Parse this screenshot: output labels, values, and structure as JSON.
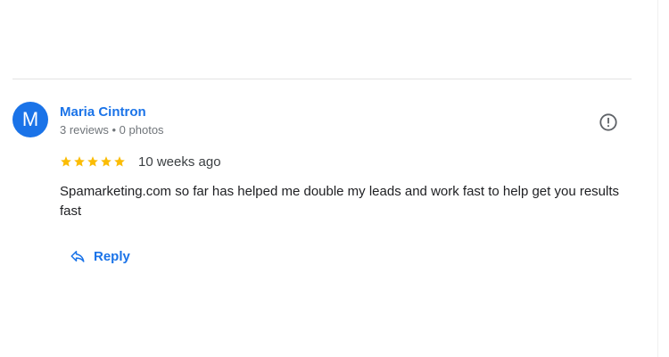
{
  "review": {
    "author": {
      "initial": "M",
      "name": "Maria Cintron",
      "meta": "3 reviews • 0 photos",
      "avatar_color": "#1a73e8"
    },
    "rating": {
      "stars": 5,
      "max_stars": 5,
      "star_color": "#fbbc04"
    },
    "date": "10 weeks ago",
    "text": "Spamarketing.com so far has helped me double my leads and work fast to help get you results fast",
    "actions": {
      "reply_label": "Reply",
      "reply_icon": "reply-arrow-icon",
      "flag_icon": "report-flag-icon"
    }
  },
  "colors": {
    "link": "#1a73e8",
    "secondary_text": "#70757a",
    "divider": "#e3e3e3"
  }
}
